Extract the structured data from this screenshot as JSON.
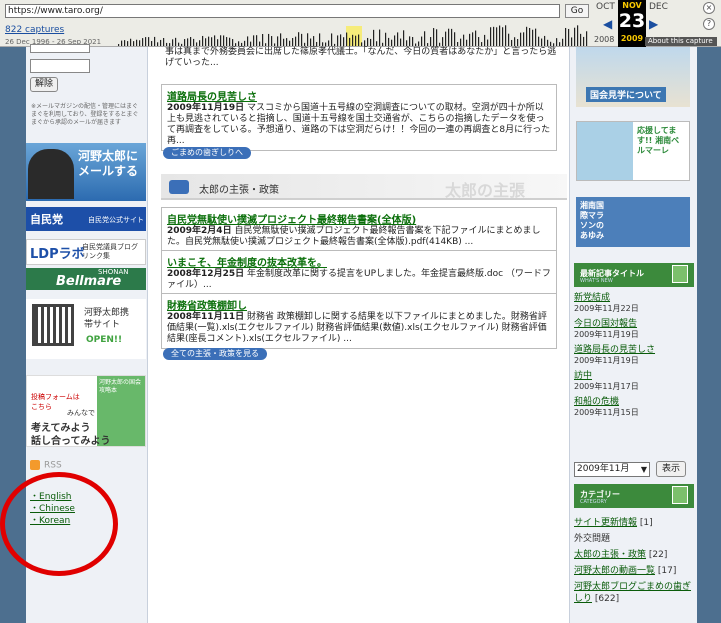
{
  "wayback": {
    "url": "https://www.taro.org/",
    "go_label": "Go",
    "captures": "822 captures",
    "range": "26 Dec 1996 - 26 Sep 2021",
    "prev_month": "OCT",
    "cur_month": "NOV",
    "next_month": "DEC",
    "cur_day": "23",
    "prev_year": "2008",
    "cur_year": "2009",
    "about": "About this capture",
    "close": "×",
    "help": "?"
  },
  "left": {
    "unsubscribe_label": "解除",
    "mag_note": "※メールマガジンの配信・管理にはまぐまぐを利用しており、登録をするとまぐまぐから承認のメールが届きます",
    "mail_banner": "河野太郎にメールする",
    "ldp_label": "自民党",
    "ldp_sub": "自民党公式サイト",
    "blog_logo": "LDPラボ",
    "blog_sub": "自民党議員ブログリンク集",
    "bell_small": "SHONAN",
    "bell_label": "Bellmare",
    "mobile_title": "河野太郎携帯サイト",
    "mobile_open": "OPEN!!",
    "form_book": "河野太郎の国会攻略本",
    "form_line1": "投稿フォームは",
    "form_line2": "こちら",
    "form_line3": "みんなで",
    "form_line4": "考えてみよう",
    "form_line5": "話し合ってみよう",
    "rss": "RSS",
    "languages": [
      "English",
      "Chinese",
      "Korean"
    ]
  },
  "center": {
    "top_fragment": "事は真まで外務委員会に出席した篠原孝代議士。「なんだ、今日の質者はあなたか」と言ったら逃げていった...",
    "post1_title": "道路局長の見苦しさ",
    "post1_date": "2009年11月19日",
    "post1_body": "マスコミから国道十五号線の空洞調査についての取材。空洞が四十か所以上も見逃されていると指摘し、国道十五号線を国土交通省が、こちらの指摘したデータを使って再調査をしている。予想通り、道路の下は空洞だらけ！！今回の一連の再調査と8月に行った再...",
    "btn_gomame": "ごまめの歯ぎしりへ",
    "section_title": "太郎の主張・政策",
    "section_ghost": "太郎の主張",
    "post2_title": "自民党無駄使い撲滅プロジェクト最終報告書案(全体版)",
    "post2_date": "2009年2月4日",
    "post2_body": "自民党無駄使い撲滅プロジェクト最終報告書案を下記ファイルにまとめました。自民党無駄使い撲滅プロジェクト最終報告書案(全体版).pdf(414KB) ...",
    "post3_title": "いまこそ、年金制度の抜本改革を。",
    "post3_date": "2008年12月25日",
    "post3_body": "年金制度改革に関する提言をUPしました。年金提言最終版.doc （ワードファイル）...",
    "post4_title": "財務省政策棚卸し",
    "post4_date": "2008年11月11日",
    "post4_body": "財務省 政策棚卸しに関する結果を以下ファイルにまとめました。財務省評価結果(一覧).xls(エクセルファイル) 財務省評価結果(数値).xls(エクセルファイル) 財務省評価結果(座長コメント).xls(エクセルファイル) ...",
    "btn_all": "全ての主張・政策を見る"
  },
  "right": {
    "diet_label": "国会見学について",
    "bell_text": "応援してます!! 湘南ベルマーレ",
    "marathon_text": "湘南国際マラソンのあゆみ",
    "recent_head": "最新記事タイトル",
    "recent_head_sub": "WHAT'S NEW",
    "recent": [
      {
        "title": "新党結成",
        "date": "2009年11月22日"
      },
      {
        "title": "今日の国対報告",
        "date": "2009年11月19日"
      },
      {
        "title": "道路局長の見苦しさ",
        "date": "2009年11月19日"
      },
      {
        "title": "訪中",
        "date": "2009年11月17日"
      },
      {
        "title": "和船の危機",
        "date": "2009年11月15日"
      }
    ],
    "month_value": "2009年11月",
    "show_label": "表示",
    "cat_head": "カテゴリー",
    "cat_head_sub": "CATEGORY",
    "categories": [
      {
        "name": "サイト更新情報",
        "count": "[1]",
        "link": true
      },
      {
        "name": "外交問題",
        "count": "",
        "link": false
      },
      {
        "name": "太郎の主張・政策",
        "count": "[22]",
        "link": true
      },
      {
        "name": "河野太郎の動画一覧",
        "count": "[17]",
        "link": true
      },
      {
        "name": "河野太郎ブログごまめの歯ぎしり",
        "count": "[622]",
        "link": true
      }
    ]
  },
  "colors": {
    "link_green": "#0a6f0a",
    "accent_blue": "#3b6fb8",
    "circle_red": "#e00000"
  }
}
